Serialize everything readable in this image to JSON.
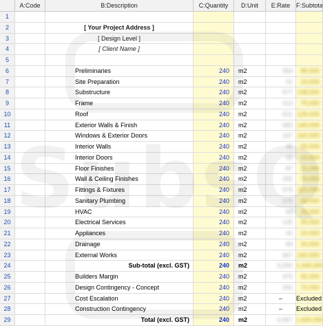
{
  "columns": [
    "A:Code",
    "B:Description",
    "C:Quantity",
    "D:Unit",
    "E:Rate",
    "F:Subtotal"
  ],
  "header_lines": {
    "project_address": "[ Your Project Address ]",
    "design_level": "[ Design Level ]",
    "client_name": "[ Client Name ]"
  },
  "items": [
    {
      "row": "6",
      "desc": "Preliminaries",
      "qty": "240",
      "unit": "m2",
      "rate": "354",
      "subtotal": "85,000"
    },
    {
      "row": "7",
      "desc": "Site Preparation",
      "qty": "240",
      "unit": "m2",
      "rate": "31",
      "subtotal": "15,000"
    },
    {
      "row": "8",
      "desc": "Substructure",
      "qty": "240",
      "unit": "m2",
      "rate": "577",
      "subtotal": "138,000"
    },
    {
      "row": "9",
      "desc": "Frame",
      "qty": "240",
      "unit": "m2",
      "rate": "413",
      "subtotal": "75,000"
    },
    {
      "row": "10",
      "desc": "Roof",
      "qty": "240",
      "unit": "m2",
      "rate": "521",
      "subtotal": "125,000"
    },
    {
      "row": "11",
      "desc": "Exterior Walls & Finish",
      "qty": "240",
      "unit": "m2",
      "rate": "583",
      "subtotal": "140,000"
    },
    {
      "row": "12",
      "desc": "Windows & Exterior Doors",
      "qty": "240",
      "unit": "m2",
      "rate": "167",
      "subtotal": "160,000"
    },
    {
      "row": "13",
      "desc": "Interior Walls",
      "qty": "240",
      "unit": "m2",
      "rate": "46",
      "subtotal": "55,000"
    },
    {
      "row": "14",
      "desc": "Interior Doors",
      "qty": "240",
      "unit": "m2",
      "rate": "42",
      "subtotal": "10,000"
    },
    {
      "row": "15",
      "desc": "Floor Finishes",
      "qty": "240",
      "unit": "m2",
      "rate": "87",
      "subtotal": "21,000"
    },
    {
      "row": "16",
      "desc": "Wall & Ceiling Finishes",
      "qty": "240",
      "unit": "m2",
      "rate": "292",
      "subtotal": "70,000"
    },
    {
      "row": "17",
      "desc": "Fittings & Fixtures",
      "qty": "240",
      "unit": "m2",
      "rate": "479",
      "subtotal": "115,000"
    },
    {
      "row": "18",
      "desc": "Sanitary Plumbing",
      "qty": "240",
      "unit": "m2",
      "rate": "175",
      "subtotal": "42,000"
    },
    {
      "row": "19",
      "desc": "HVAC",
      "qty": "240",
      "unit": "m2",
      "rate": "83",
      "subtotal": "20,000"
    },
    {
      "row": "20",
      "desc": "Electrical Services",
      "qty": "240",
      "unit": "m2",
      "rate": "125",
      "subtotal": "30,000"
    },
    {
      "row": "21",
      "desc": "Appliances",
      "qty": "240",
      "unit": "m2",
      "rate": "42",
      "subtotal": "10,000"
    },
    {
      "row": "22",
      "desc": "Drainage",
      "qty": "240",
      "unit": "m2",
      "rate": "83",
      "subtotal": "20,000"
    },
    {
      "row": "23",
      "desc": "External Works",
      "qty": "240",
      "unit": "m2",
      "rate": "667",
      "subtotal": "160,000"
    }
  ],
  "subtotal_row": {
    "row": "24",
    "desc": "Sub-total (excl. GST)",
    "qty": "240",
    "unit": "m2",
    "rate": "6,000",
    "subtotal": "1,440,000"
  },
  "extra_rows": [
    {
      "row": "25",
      "desc": "Builders Margin",
      "qty": "240",
      "unit": "m2",
      "rate": "375",
      "subtotal": "90,000"
    },
    {
      "row": "26",
      "desc": "Design Contingency - Concept",
      "qty": "240",
      "unit": "m2",
      "rate": "292",
      "subtotal": "70,000"
    },
    {
      "row": "27",
      "desc": "Cost Escalation",
      "qty": "240",
      "unit": "m2",
      "rate": "–",
      "subtotal": "Excluded"
    },
    {
      "row": "28",
      "desc": "Construction Contingency",
      "qty": "240",
      "unit": "m2",
      "rate": "–",
      "subtotal": "Excluded"
    }
  ],
  "total_row": {
    "row": "29",
    "desc": "Total (excl. GST)",
    "qty": "240",
    "unit": "m2",
    "rate": "6,667",
    "subtotal": "1,600,000"
  },
  "watermark": "SubsQS",
  "colors": {
    "highlight": "#fffbd0",
    "row_number": "#1f4fb3",
    "quantity": "#1530c9"
  }
}
